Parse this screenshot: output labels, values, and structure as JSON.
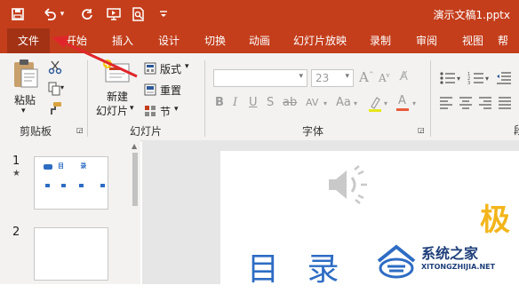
{
  "app": {
    "doc_title": "演示文稿1.pptx"
  },
  "quick_access": [
    "save-icon",
    "undo-icon",
    "redo-icon",
    "present-from-start-icon",
    "print-preview-icon",
    "customize-dropdown-icon"
  ],
  "tabs": [
    "文件",
    "开始",
    "插入",
    "设计",
    "切换",
    "动画",
    "幻灯片放映",
    "录制",
    "审阅",
    "视图",
    "帮"
  ],
  "ribbon": {
    "clipboard": {
      "paste_label": "粘贴",
      "group_label": "剪贴板"
    },
    "slides": {
      "new_slide_line1": "新建",
      "new_slide_line2": "幻灯片",
      "layout_label": "版式",
      "reset_label": "重置",
      "section_label": "节",
      "group_label": "幻灯片"
    },
    "font": {
      "size_value": "23",
      "group_label": "字体"
    }
  },
  "slide_panel": {
    "slide1_number": "1",
    "slide1_star": "★",
    "slide1_thumb_text": "目 录",
    "slide2_number": "2"
  },
  "editor": {
    "heading": "目 录",
    "decor_char": "极"
  },
  "watermark": {
    "brand": "系统之家",
    "url": "XITONGZHIJIA.NET"
  },
  "colors": {
    "title_bar": "#c43e1c",
    "active_tab": "#a33215",
    "arrow": "#e0262b",
    "heading_blue": "#2e6cc4"
  }
}
